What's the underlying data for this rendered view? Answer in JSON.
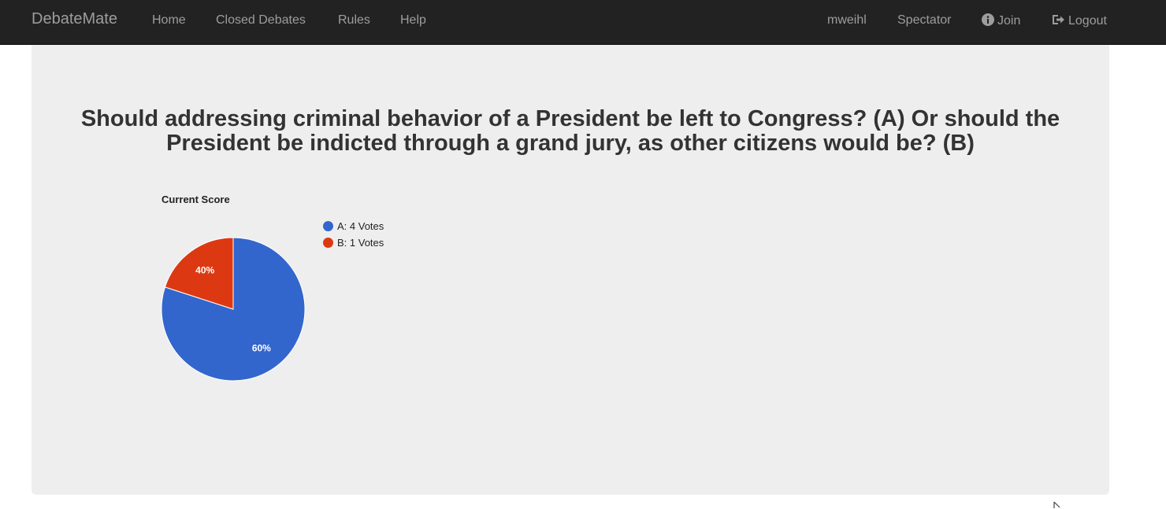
{
  "navbar": {
    "brand": "DebateMate",
    "left_links": [
      "Home",
      "Closed Debates",
      "Rules",
      "Help"
    ],
    "user": "mweihl",
    "role": "Spectator",
    "join": "Join",
    "logout": "Logout"
  },
  "debate": {
    "question": "Should addressing criminal behavior of a President be left to Congress? (A) Or should the President be indicted through a grand jury, as other citizens would be? (B)"
  },
  "chart_data": {
    "type": "pie",
    "title": "Current Score",
    "categories": [
      "A: 4 Votes",
      "B: 1 Votes"
    ],
    "values": [
      4,
      1
    ],
    "colors": [
      "#3366cc",
      "#dc3912"
    ],
    "slice_labels": [
      "60%",
      "40%"
    ],
    "legend_position": "right"
  }
}
